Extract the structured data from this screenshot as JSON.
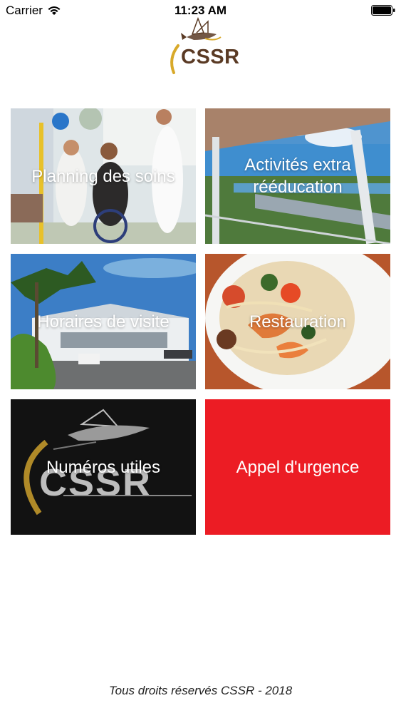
{
  "status_bar": {
    "carrier": "Carrier",
    "time": "11:23 AM",
    "wifi_icon": "wifi-icon",
    "battery_icon": "battery-icon"
  },
  "logo": {
    "text": "CSSR",
    "icon": "flying-fish-icon",
    "colors": {
      "text": "#5a3a24",
      "arc": "#d8a92a"
    }
  },
  "tiles": [
    {
      "label": "Planning des soins",
      "image": "rehab-physiotherapy-photo"
    },
    {
      "label": "Activités extra rééducation",
      "image": "covered-terrace-landscape-photo"
    },
    {
      "label": "Horaires de visite",
      "image": "building-with-palm-tree-photo"
    },
    {
      "label": "Restauration",
      "image": "seafood-pasta-dish-photo"
    },
    {
      "label": "Numéros utiles",
      "image": "cssr-sign-photo"
    },
    {
      "label": "Appel d'urgence",
      "color": "#ec1c24"
    }
  ],
  "footer": "Tous droits réservés CSSR - 2018"
}
